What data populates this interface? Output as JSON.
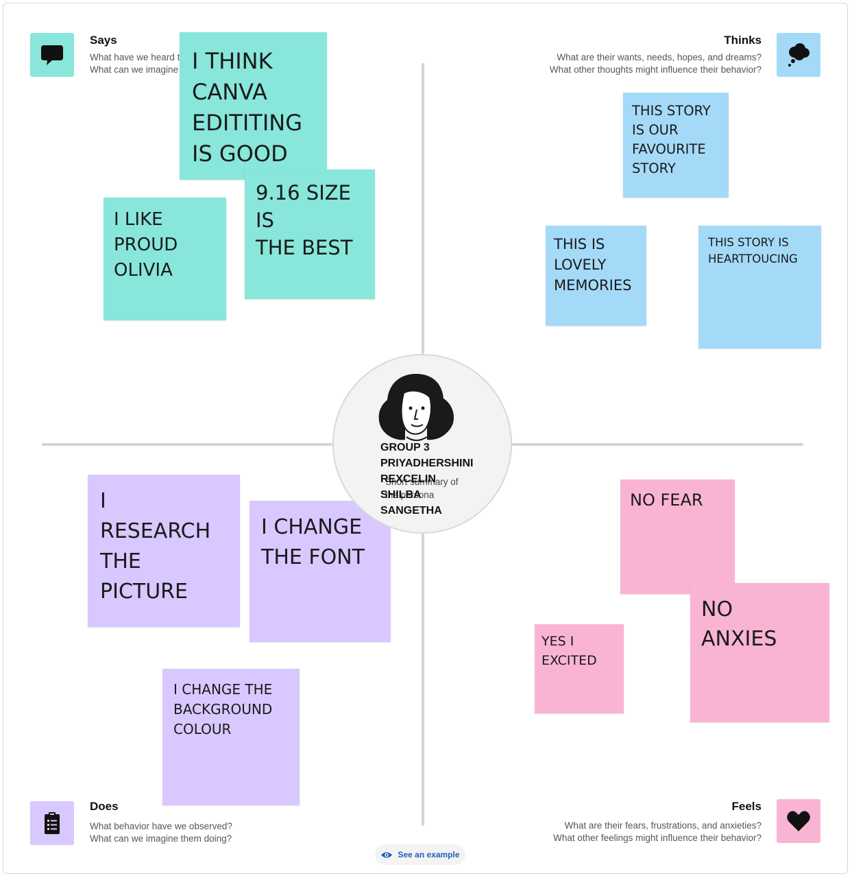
{
  "quadrants": {
    "says": {
      "title": "Says",
      "sub1": "What have we heard them say?",
      "sub2": "What can we imagine them saying?",
      "icon": "speech-bubble-icon",
      "color": "#88e6da"
    },
    "thinks": {
      "title": "Thinks",
      "sub1": "What are their wants, needs, hopes, and dreams?",
      "sub2": "What other thoughts might influence their behavior?",
      "icon": "thought-cloud-icon",
      "color": "#a4daf8"
    },
    "does": {
      "title": "Does",
      "sub1": "What behavior have we observed?",
      "sub2": "What can we imagine them doing?",
      "icon": "clipboard-icon",
      "color": "#d8c8ff"
    },
    "feels": {
      "title": "Feels",
      "sub1": "What are their fears, frustrations, and anxieties?",
      "sub2": "What other feelings might influence their behavior?",
      "icon": "heart-icon",
      "color": "#fab4d3"
    }
  },
  "notes": {
    "says": [
      {
        "lines": [
          "I THINK",
          "CANVA",
          "EDITITING",
          "IS GOOD"
        ]
      },
      {
        "lines": [
          "9.16 SIZE IS",
          "THE BEST"
        ]
      },
      {
        "lines": [
          "I LIKE",
          "PROUD",
          "OLIVIA"
        ]
      }
    ],
    "thinks": [
      {
        "lines": [
          "THIS STORY",
          "IS OUR",
          "FAVOURITE",
          "STORY"
        ]
      },
      {
        "lines": [
          "THIS IS",
          "LOVELY",
          "MEMORIES"
        ]
      },
      {
        "lines": [
          "THIS STORY IS",
          "HEARTTOUCING"
        ]
      }
    ],
    "does": [
      {
        "lines": [
          "I",
          "RESEARCH",
          "THE",
          "PICTURE"
        ]
      },
      {
        "lines": [
          "I CHANGE",
          "THE FONT"
        ]
      },
      {
        "lines": [
          "I CHANGE THE",
          "BACKGROUND",
          "COLOUR"
        ]
      }
    ],
    "feels": [
      {
        "lines": [
          "NO FEAR"
        ]
      },
      {
        "lines": [
          "NO",
          "ANXIES"
        ]
      },
      {
        "lines": [
          "YES I",
          "EXCITED"
        ]
      }
    ]
  },
  "persona": {
    "names": [
      "GROUP 3",
      "PRIYADHERSHINI",
      "REXCELIN",
      "SHILBA",
      "SANGETHA"
    ],
    "summary": "Short summary of the persona",
    "avatar_icon": "persona-avatar-icon"
  },
  "example_button": {
    "label": "See an example",
    "icon": "eye-icon",
    "color": "#1f5fb8"
  }
}
